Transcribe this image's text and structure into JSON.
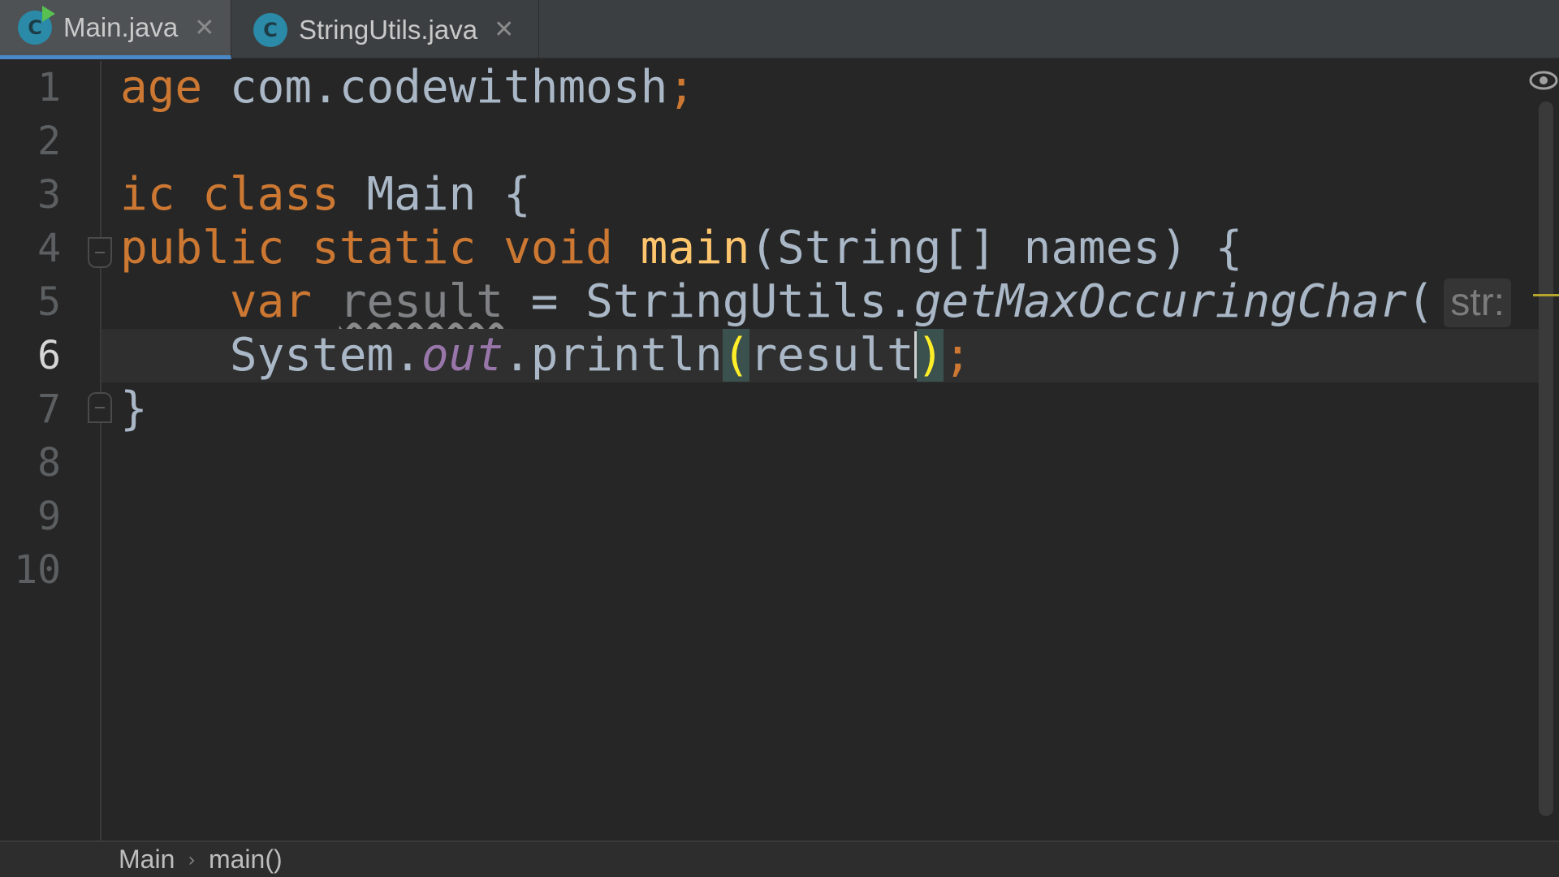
{
  "tabs": [
    {
      "label": "Main.java",
      "icon": "java-class-run-icon",
      "active": true
    },
    {
      "label": "StringUtils.java",
      "icon": "java-class-icon",
      "active": false
    }
  ],
  "tab_icon_letter": "C",
  "tab_close_glyph": "✕",
  "line_numbers": [
    "1",
    "2",
    "3",
    "4",
    "5",
    "6",
    "7",
    "8",
    "9",
    "10"
  ],
  "current_line": "6",
  "code": {
    "line1": {
      "kw": "age",
      "rest": " com.codewithmosh",
      "semi": ";"
    },
    "line3": {
      "kw1": "ic",
      "kw2": "class",
      "name": " Main {"
    },
    "line4": {
      "kw1": "public",
      "kw2": "static",
      "kw3": "void",
      "fn": "main",
      "rest": "(String[] names) {"
    },
    "line5": {
      "kw": "var",
      "var": "result",
      "eq": " = StringUtils.",
      "method": "getMaxOccuringChar",
      "paren": "(",
      "hint": "str:"
    },
    "line6": {
      "obj": "System.",
      "field": "out",
      "method": ".println",
      "open": "(",
      "arg": "result",
      "close": ")",
      "semi": ";"
    },
    "line7": {
      "brace": "}"
    }
  },
  "breadcrumb": {
    "class": "Main",
    "method": "main()",
    "separator": "›"
  },
  "colors": {
    "keyword": "#cc7832",
    "function": "#ffc66d",
    "field": "#9876aa",
    "text": "#a9b7c6",
    "active_tab_underline": "#4a88c7"
  }
}
